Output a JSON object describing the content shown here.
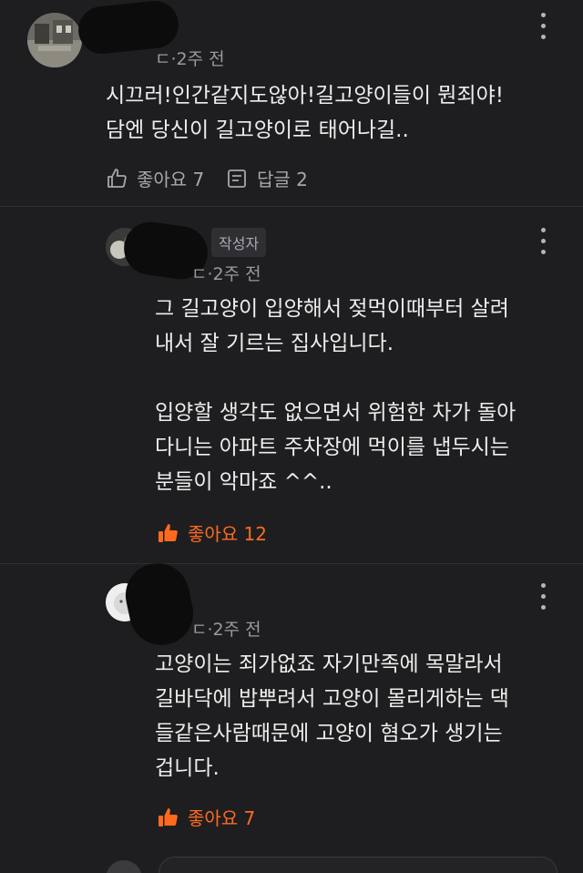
{
  "comments": [
    {
      "time": "ㄷ·2주 전",
      "body": "시끄러!인간같지도않아!길고양이들이 뭔죄야!\n담엔 당신이 길고양이로 태어나길..",
      "like_label": "좋아요 7",
      "reply_label": "답글 2"
    },
    {
      "author_badge": "작성자",
      "time": "ㄷ·2주 전",
      "body": "그 길고양이 입양해서 젖먹이때부터 살려\n내서 잘 기르는 집사입니다.\n\n입양할 생각도 없으면서 위험한 차가 돌아\n다니는 아파트 주차장에 먹이를 냅두시는\n분들이 악마죠 ^^..",
      "like_label": "좋아요 12"
    },
    {
      "time": "ㄷ·2주 전",
      "body": "고양이는 죄가없죠 자기만족에 목말라서\n길바닥에 밥뿌려서 고양이 몰리게하는 댁\n들같은사람때문에 고양이 혐오가 생기는\n겁니다.",
      "like_label": "좋아요 7"
    }
  ],
  "colors": {
    "background": "#1e1e20",
    "liked": "#ff6a1f",
    "text": "#ededed",
    "meta": "#9a9a9c"
  },
  "icons": {
    "like": "thumbs-up-icon",
    "liked": "thumbs-up-filled-icon",
    "reply": "reply-icon",
    "more": "more-vertical-icon"
  }
}
